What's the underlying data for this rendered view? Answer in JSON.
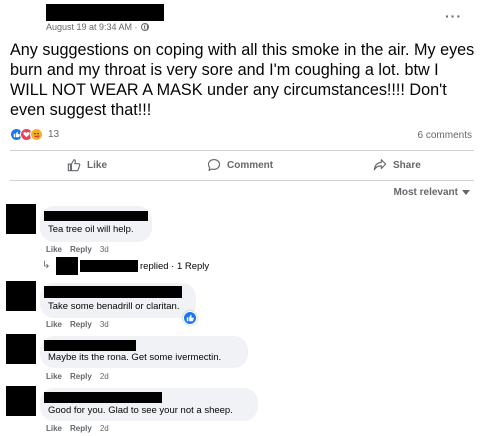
{
  "post": {
    "timestamp": "August 19 at 9:34 AM ·",
    "text": "Any suggestions on coping with all this smoke in the air. My eyes burn and my throat is very sore and I'm coughing a lot. btw I WILL NOT WEAR A MASK under any circumstances!!!! Don't even suggest that!!!",
    "reaction_count": "13",
    "comment_count": "6 comments"
  },
  "actions": {
    "like": "Like",
    "comment": "Comment",
    "share": "Share"
  },
  "sort_label": "Most relevant",
  "comments": [
    {
      "text": "Tea tree oil will help.",
      "like": "Like",
      "reply": "Reply",
      "time": "3d",
      "replies": "replied · 1 Reply"
    },
    {
      "text": "Take some benadrill or claritan.",
      "like": "Like",
      "reply": "Reply",
      "time": "3d"
    },
    {
      "text": "Maybe its the rona. Get some ivermectin.",
      "like": "Like",
      "reply": "Reply",
      "time": "2d"
    },
    {
      "text": "Good for you. Glad to see your not a sheep.",
      "like": "Like",
      "reply": "Reply",
      "time": "2d"
    }
  ],
  "colors": {
    "like_blue": "#1877f2",
    "love_red": "#f33e58",
    "care_yellow": "#f7b125",
    "bubble_gray": "#f0f2f5",
    "secondary_text": "#65676b"
  },
  "icons": [
    "more-options-icon",
    "globe-icon",
    "like-reaction-icon",
    "love-reaction-icon",
    "care-reaction-icon",
    "thumbs-up-icon",
    "comment-icon",
    "share-icon",
    "caret-down-icon",
    "reply-arrow-icon",
    "like-badge-icon"
  ]
}
